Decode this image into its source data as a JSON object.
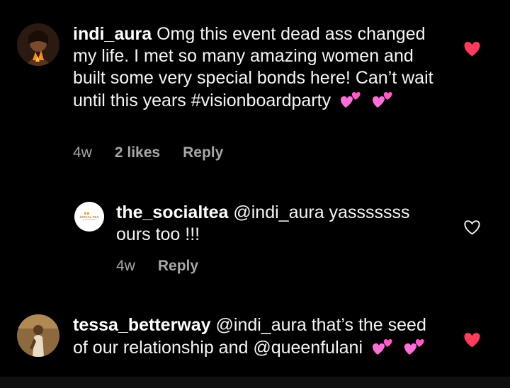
{
  "comments": [
    {
      "username": "indi_aura",
      "text": "Omg this event dead ass changed my life. I met so many amazing women and built some very special bonds here! Can’t wait until this years #visionboardparty",
      "time": "4w",
      "likes": "2 likes",
      "reply": "Reply",
      "liked": true
    },
    {
      "username": "the_socialtea",
      "text": "@indi_aura yasssssss ours too !!!",
      "time": "4w",
      "reply": "Reply",
      "liked": false,
      "avatar_text": "SOCIAL TEA"
    },
    {
      "username": "tessa_betterway",
      "text": "@indi_aura that’s the seed of our relationship and @queenfulani",
      "liked": true
    }
  ],
  "colors": {
    "background": "#000000",
    "heart_liked": "#ff3b5c",
    "meta_text": "#a8a8a8",
    "emoji_heart": "#ff6fd8"
  }
}
